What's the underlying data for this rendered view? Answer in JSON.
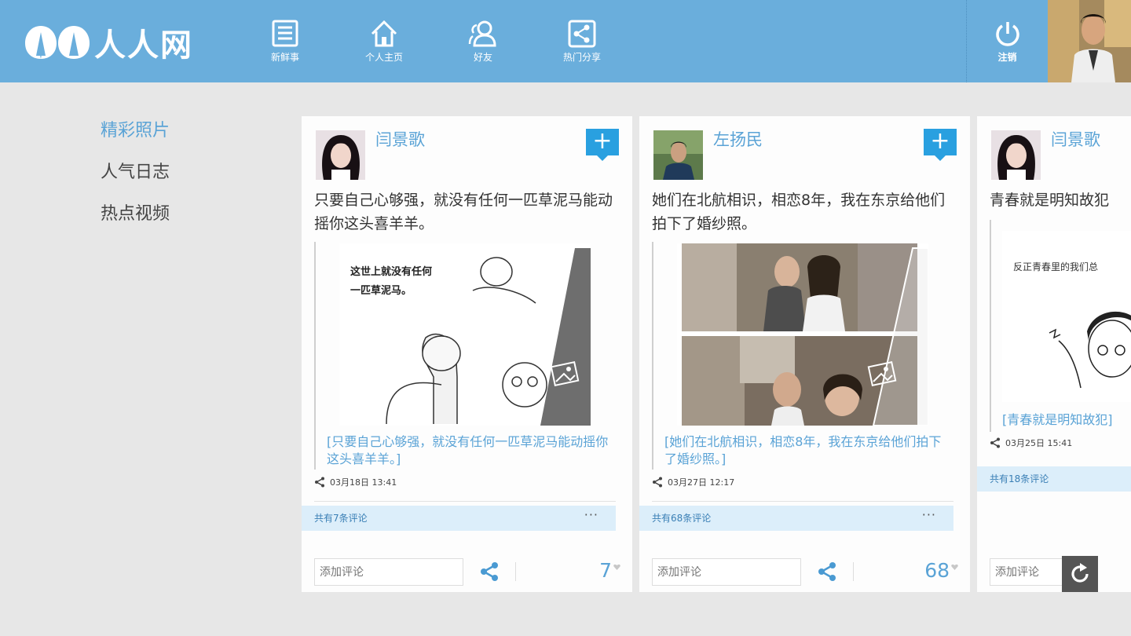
{
  "app": {
    "logo_text": "人人网"
  },
  "nav": [
    {
      "label": "新鲜事",
      "icon": "news-icon"
    },
    {
      "label": "个人主页",
      "icon": "home-icon"
    },
    {
      "label": "好友",
      "icon": "friends-icon"
    },
    {
      "label": "热门分享",
      "icon": "share-icon"
    }
  ],
  "logout": {
    "label": "注销",
    "icon": "power-icon"
  },
  "side_menu": [
    {
      "label": "精彩照片",
      "active": true
    },
    {
      "label": "人气日志",
      "active": false
    },
    {
      "label": "热点视频",
      "active": false
    }
  ],
  "cards": [
    {
      "user": "闫景歌",
      "text": "只要自己心够强，就没有任何一匹草泥马能动摇你这头喜羊羊。",
      "image_text": "这世上就没有任何一匹草泥马。",
      "caption": "[只要自己心够强，就没有任何一匹草泥马能动摇你这头喜羊羊。]",
      "time": "03月18日 13:41",
      "comments_label": "共有7条评论",
      "comment_placeholder": "添加评论",
      "likes": "7"
    },
    {
      "user": "左扬民",
      "text": "她们在北航相识，相恋8年，我在东京给他们拍下了婚纱照。",
      "caption": "[她们在北航相识，相恋8年，我在东京给他们拍下了婚纱照。]",
      "time": "03月27日 12:17",
      "comments_label": "共有68条评论",
      "comment_placeholder": "添加评论",
      "likes": "68"
    },
    {
      "user": "闫景歌",
      "text": "青春就是明知故犯",
      "image_text": "反正青春里的我们总",
      "caption": "[青春就是明知故犯]",
      "time": "03月25日 15:41",
      "comments_label": "共有18条评论",
      "comment_placeholder": "添加评论"
    }
  ],
  "colors": {
    "topbar": "#6aaedc",
    "accent": "#5aa3d6",
    "plus": "#29a0e0",
    "comment_bar": "#dceefa"
  }
}
